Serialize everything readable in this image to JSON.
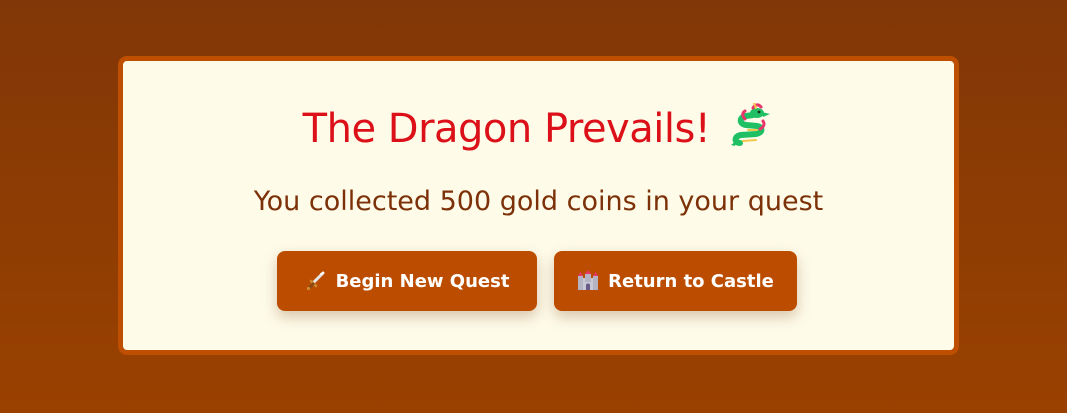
{
  "dialog": {
    "title": "The Dragon Prevails!",
    "title_icon": "dragon-icon",
    "message": "You collected 500 gold coins in your quest",
    "gold_collected": 500
  },
  "buttons": {
    "new_quest": {
      "label": "Begin New Quest",
      "icon": "sword-icon"
    },
    "return_castle": {
      "label": "Return to Castle",
      "icon": "castle-icon"
    }
  },
  "colors": {
    "background": "#8a3a04",
    "card": "#fefbe9",
    "card_border": "#bf4f00",
    "title": "#dc1018",
    "message": "#7c3108",
    "button": "#bc4d00",
    "button_text": "#ffffff"
  }
}
